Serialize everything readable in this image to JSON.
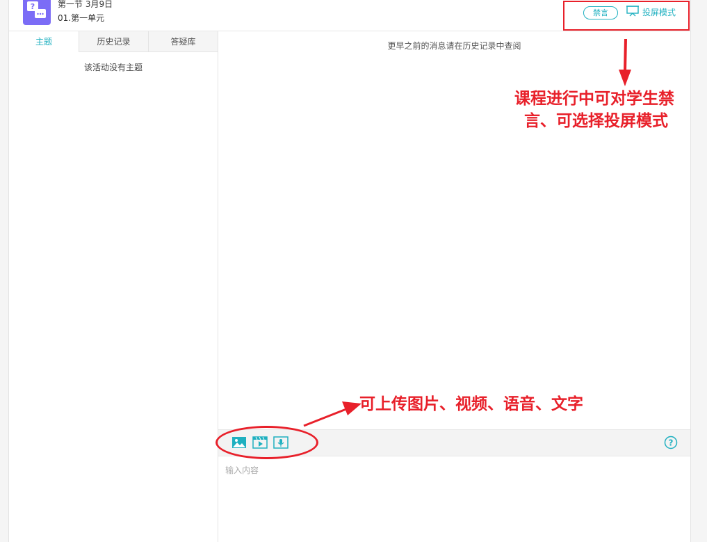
{
  "header": {
    "title": "第一节 3月9日",
    "subtitle": "01.第一单元",
    "mute_label": "禁言",
    "projection_label": "投屏模式"
  },
  "sidebar": {
    "tabs": [
      {
        "label": "主题",
        "active": true
      },
      {
        "label": "历史记录",
        "active": false
      },
      {
        "label": "答疑库",
        "active": false
      }
    ],
    "empty_message": "该活动没有主题"
  },
  "chat": {
    "history_hint": "更早之前的消息请在历史记录中查阅",
    "input_placeholder": "输入内容",
    "tools": [
      "image-icon",
      "video-icon",
      "voice-icon"
    ],
    "help_icon": "help-icon"
  },
  "annotations": {
    "top_note_line1": "课程进行中可对学生禁",
    "top_note_line2": "言、可选择投屏模式",
    "bottom_note": "可上传图片、视频、语音、文字"
  },
  "colors": {
    "accent": "#1fb0c0",
    "annotation": "#e8202a",
    "app_icon": "#7b6cf6"
  }
}
